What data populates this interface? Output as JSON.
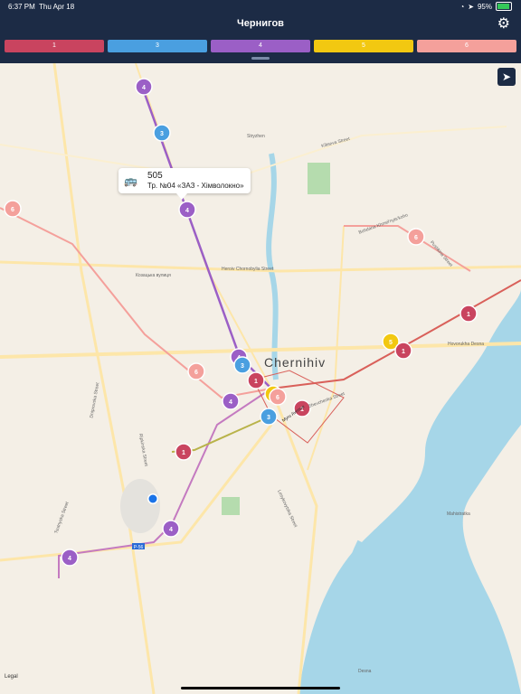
{
  "status_bar": {
    "time": "6:37 PM",
    "date": "Thu Apr 18",
    "battery": "95%"
  },
  "header": {
    "title": "Чернигов",
    "settings_icon": "gear-icon"
  },
  "tabs": [
    {
      "label": "1",
      "color": "#c9445f"
    },
    {
      "label": "3",
      "color": "#4a9fe0"
    },
    {
      "label": "4",
      "color": "#9b5fc6"
    },
    {
      "label": "5",
      "color": "#f2c811"
    },
    {
      "label": "6",
      "color": "#f4a09b"
    }
  ],
  "map": {
    "city_label": "Chernihiv",
    "street_labels": [
      "Kiltseva Street",
      "Козацька вулиця",
      "Heroiv Chornobylia Street",
      "Bohdana Khmel'nyts'koho",
      "Pushkina Street",
      "Shevchenka Street",
      "Myru Avenue",
      "Lesykovytska Street",
      "Dniprovska Street",
      "Ripkinska Street",
      "Tsutnyska Street",
      "Stryzhen",
      "Mahistratka",
      "Hovorukha Desna",
      "Desna"
    ],
    "route_badge": "P-56",
    "legal": "Legal"
  },
  "callout": {
    "vehicle_number": "505",
    "route_text": "Тр. №04 «ЗАЗ - Хімволокно»",
    "icon": "bus-icon"
  },
  "markers": [
    {
      "route": "4"
    },
    {
      "route": "3"
    },
    {
      "route": "4"
    },
    {
      "route": "6"
    },
    {
      "route": "6"
    },
    {
      "route": "1"
    },
    {
      "route": "5"
    },
    {
      "route": "1"
    },
    {
      "route": "6"
    },
    {
      "route": "4"
    },
    {
      "route": "3"
    },
    {
      "route": "1"
    },
    {
      "route": "4"
    },
    {
      "route": "5"
    },
    {
      "route": "6"
    },
    {
      "route": "3"
    },
    {
      "route": "1"
    },
    {
      "route": "1"
    },
    {
      "route": "4"
    },
    {
      "route": "4"
    }
  ],
  "locate_icon": "location-arrow-icon"
}
